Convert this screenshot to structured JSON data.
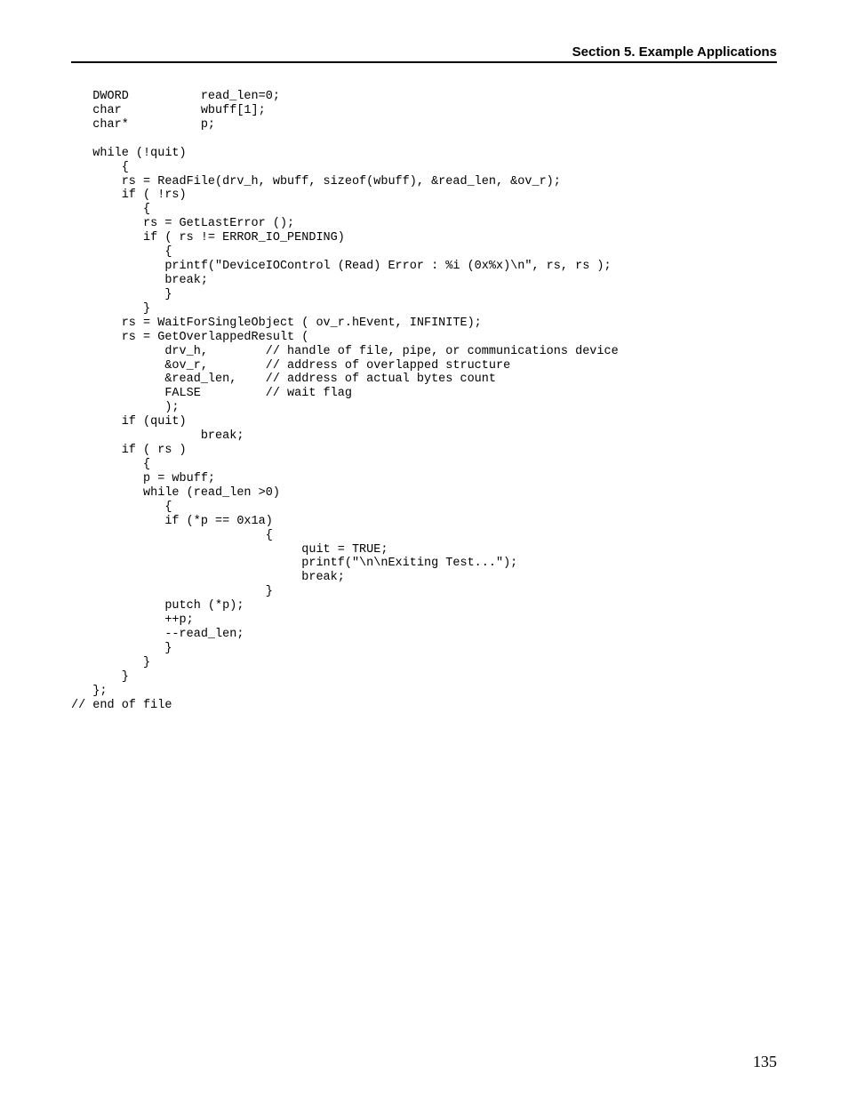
{
  "header": "Section 5.  Example Applications",
  "page_number": "135",
  "code": "   DWORD          read_len=0;\n   char           wbuff[1];\n   char*          p;\n\n   while (!quit)\n       {\n       rs = ReadFile(drv_h, wbuff, sizeof(wbuff), &read_len, &ov_r);\n       if ( !rs)\n          {\n          rs = GetLastError ();\n          if ( rs != ERROR_IO_PENDING)\n             {\n             printf(\"DeviceIOControl (Read) Error : %i (0x%x)\\n\", rs, rs );\n             break;\n             }\n          }\n       rs = WaitForSingleObject ( ov_r.hEvent, INFINITE);\n       rs = GetOverlappedResult (\n             drv_h,        // handle of file, pipe, or communications device\n             &ov_r,        // address of overlapped structure\n             &read_len,    // address of actual bytes count\n             FALSE         // wait flag\n             );\n       if (quit)\n                  break;\n       if ( rs )\n          {\n          p = wbuff;\n          while (read_len >0)\n             {\n             if (*p == 0x1a)\n                           {\n                                quit = TRUE;\n                                printf(\"\\n\\nExiting Test...\");\n                                break;\n                           }\n             putch (*p);\n             ++p;\n             --read_len;\n             }\n          }\n       }\n   };\n// end of file"
}
